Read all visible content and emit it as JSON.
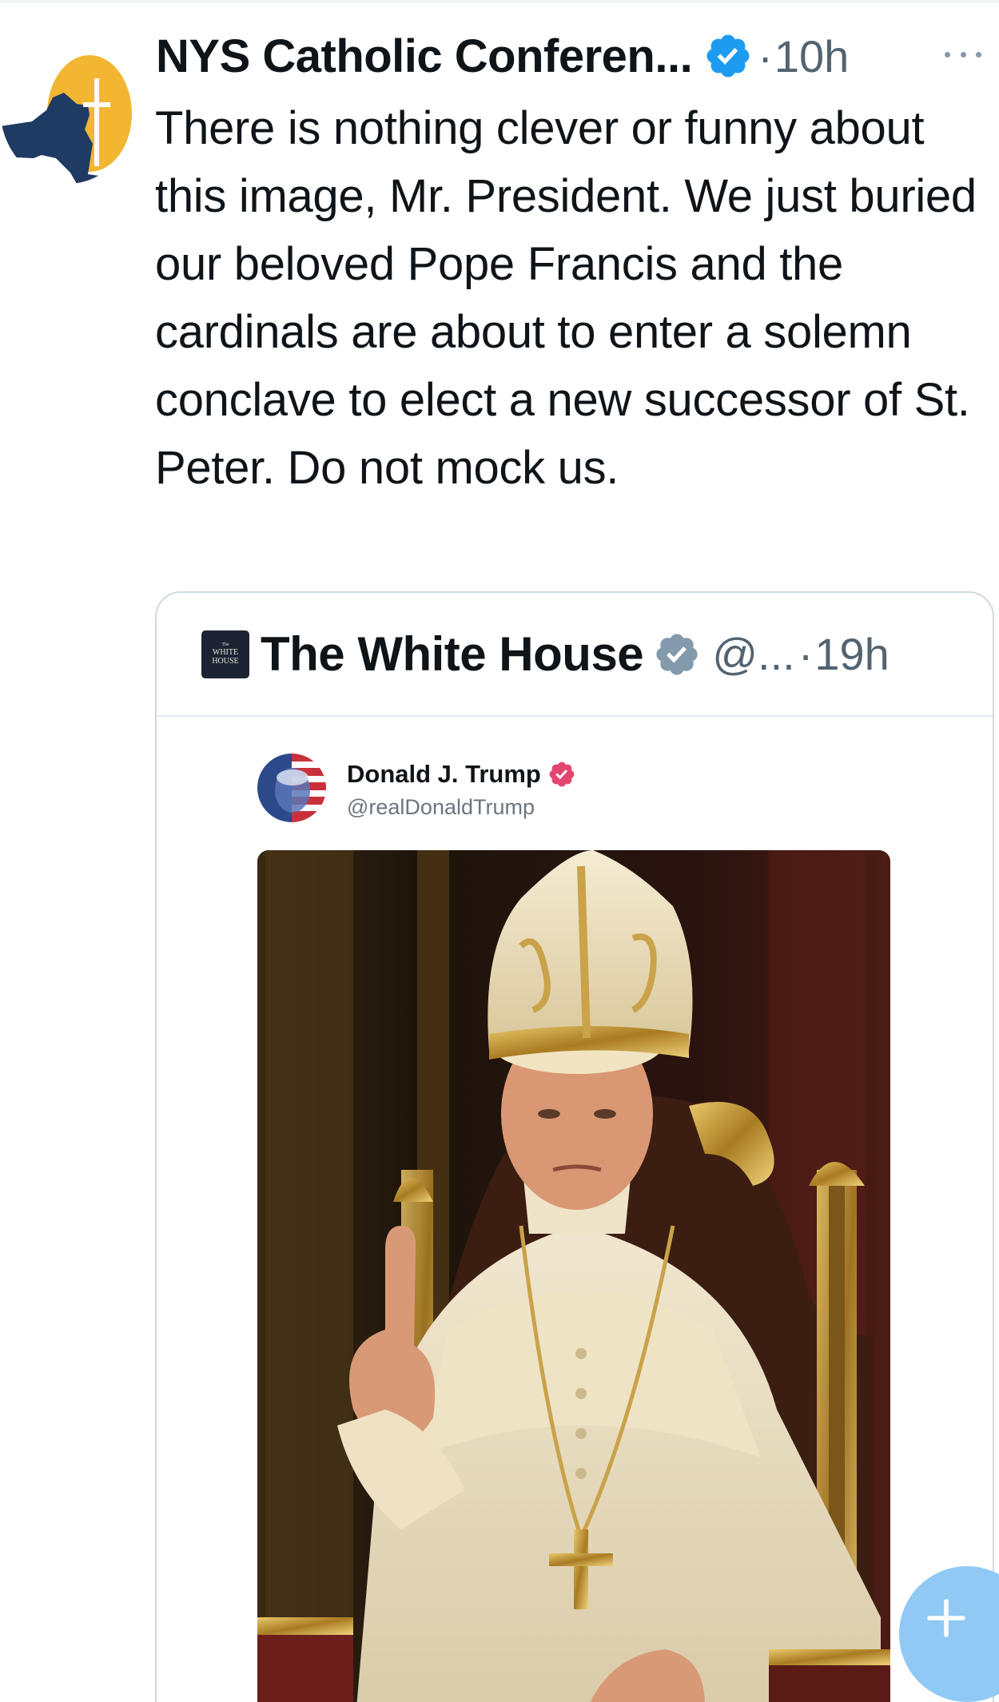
{
  "tweet": {
    "author_name": "NYS Catholic Conferen...",
    "time_separator": "·",
    "time": "10h",
    "text": "There is nothing clever or funny about this image, Mr. President. We just buried our beloved Pope Francis and the cardinals are about to enter a solemn conclave to elect a new successor of St. Peter. Do not mock us."
  },
  "quoted": {
    "author_name": "The White House",
    "handle": "@...",
    "time_separator": "·",
    "time": "19h",
    "logo_lines": [
      "The",
      "WHITE",
      "HOUSE"
    ],
    "embedded_post": {
      "author_name": "Donald J. Trump",
      "handle": "@realDonaldTrump"
    }
  },
  "icons": {
    "verified": "verified-badge-icon",
    "more": "more-options-icon",
    "compose": "compose-plus-icon"
  },
  "colors": {
    "verified_blue": "#1d9bf0",
    "verified_gray": "#829aab",
    "truth_badge": "#e2456d",
    "compose_fab": "#90c9f4",
    "muted_text": "#536471"
  }
}
